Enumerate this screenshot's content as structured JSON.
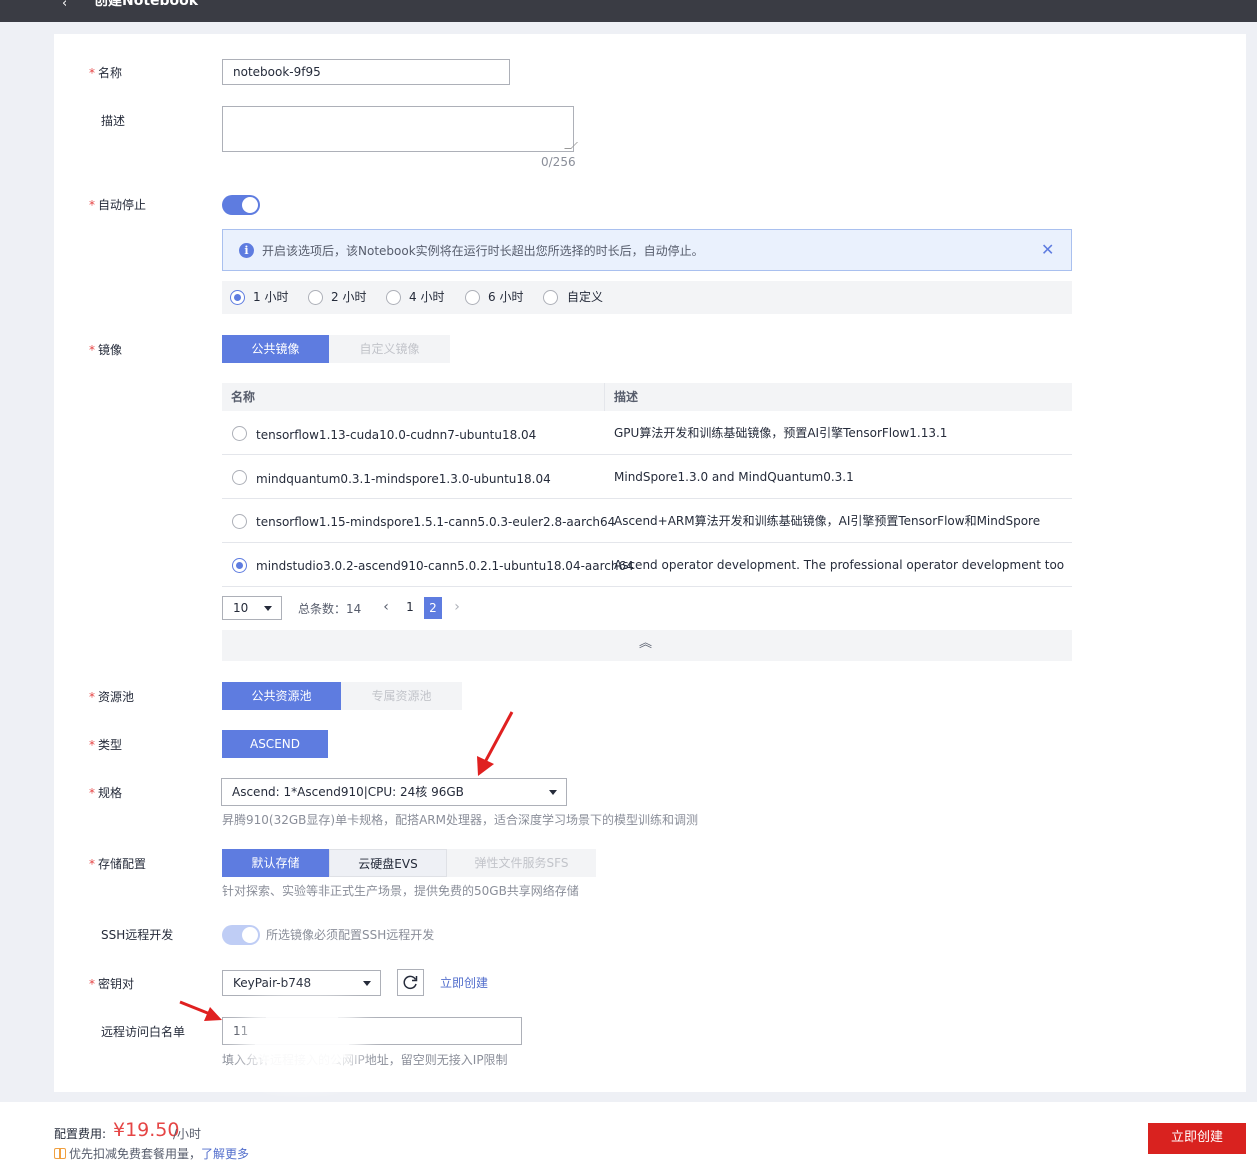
{
  "header": {
    "back": "‹",
    "title": "创建Notebook"
  },
  "form": {
    "name": {
      "label": "名称",
      "value": "notebook-9f95"
    },
    "description": {
      "label": "描述",
      "counter": "0/256"
    },
    "auto_stop": {
      "label": "自动停止",
      "alert": "开启该选项后，该Notebook实例将在运行时长超出您所选择的时长后，自动停止。",
      "options": [
        "1 小时",
        "2 小时",
        "4 小时",
        "6 小时",
        "自定义"
      ],
      "selected": "1 小时"
    },
    "image": {
      "label": "镜像",
      "tabs": [
        "公共镜像",
        "自定义镜像"
      ],
      "columns": [
        "名称",
        "描述"
      ],
      "rows": [
        {
          "name": "tensorflow1.13-cuda10.0-cudnn7-ubuntu18.04",
          "desc": "GPU算法开发和训练基础镜像，预置AI引擎TensorFlow1.13.1"
        },
        {
          "name": "mindquantum0.3.1-mindspore1.3.0-ubuntu18.04",
          "desc": "MindSpore1.3.0 and MindQuantum0.3.1"
        },
        {
          "name": "tensorflow1.15-mindspore1.5.1-cann5.0.3-euler2.8-aarch64",
          "desc": "Ascend+ARM算法开发和训练基础镜像，AI引擎预置TensorFlow和MindSpore"
        },
        {
          "name": "mindstudio3.0.2-ascend910-cann5.0.2.1-ubuntu18.04-aarch64",
          "desc": "Ascend operator development. The professional operator development tool Min..."
        }
      ],
      "pager": {
        "page_size": "10",
        "total": "总条数：14",
        "prev": "‹",
        "pages": [
          "1",
          "2"
        ],
        "current": "2",
        "next": "›"
      },
      "collapse": "︽"
    },
    "resource_pool": {
      "label": "资源池",
      "tabs": [
        "公共资源池",
        "专属资源池"
      ]
    },
    "type": {
      "label": "类型",
      "value": "ASCEND"
    },
    "spec": {
      "label": "规格",
      "value": "Ascend: 1*Ascend910|CPU: 24核 96GB",
      "hint": "昇腾910(32GB显存)单卡规格，配搭ARM处理器，适合深度学习场景下的模型训练和调测"
    },
    "storage": {
      "label": "存储配置",
      "tabs": [
        "默认存储",
        "云硬盘EVS",
        "弹性文件服务SFS"
      ],
      "hint": "针对探索、实验等非正式生产场景，提供免费的50GB共享网络存储"
    },
    "ssh": {
      "label": "SSH远程开发",
      "text": "所选镜像必须配置SSH远程开发"
    },
    "keypair": {
      "label": "密钥对",
      "value": "KeyPair-b748",
      "create": "立即创建"
    },
    "whitelist": {
      "label": "远程访问白名单",
      "value": "11",
      "hint": "填入允许远程接入的公网IP地址，留空则无接入IP限制"
    }
  },
  "footer": {
    "cost_label": "配置费用:",
    "price": "¥19.50",
    "unit": "/小时",
    "note": "优先扣减免费套餐用量，",
    "learn_more": "了解更多",
    "create_button": "立即创建"
  },
  "colors": {
    "primary": "#5e7ce0",
    "danger": "#d9221f",
    "required": "#e54545",
    "arrow": "#e02020"
  }
}
